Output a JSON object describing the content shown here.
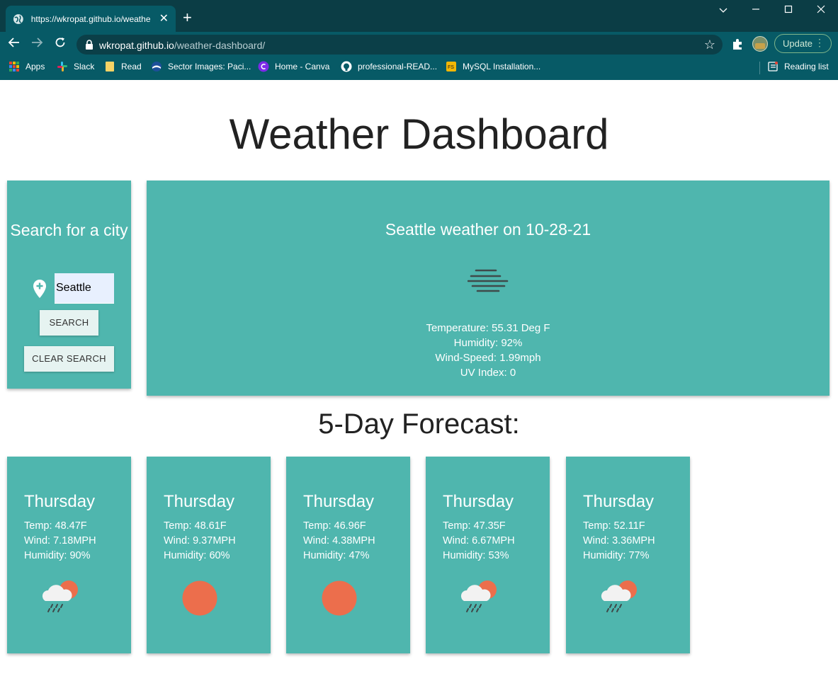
{
  "browser": {
    "tab_title": "https://wkropat.github.io/weathe",
    "tab_close": "✕",
    "new_tab": "+",
    "url_domain": "wkropat.github.io",
    "url_path": "/weather-dashboard/",
    "update_label": "Update",
    "bookmarks": [
      {
        "label": "Apps",
        "icon": "apps-grid-icon"
      },
      {
        "label": "Slack",
        "icon": "slack-icon"
      },
      {
        "label": "Read",
        "icon": "folder-icon"
      },
      {
        "label": "Sector Images: Paci...",
        "icon": "noaa-icon"
      },
      {
        "label": "Home - Canva",
        "icon": "canva-icon"
      },
      {
        "label": "professional-READ...",
        "icon": "github-icon"
      },
      {
        "label": "MySQL Installation...",
        "icon": "mysql-icon"
      }
    ],
    "reading_list": "Reading list"
  },
  "page": {
    "title": "Weather Dashboard"
  },
  "search": {
    "heading": "Search for a city",
    "input_value": "Seattle",
    "search_button": "SEARCH",
    "clear_button": "CLEAR SEARCH"
  },
  "current": {
    "title": "Seattle weather on 10-28-21",
    "icon": "fog-icon",
    "temperature": "Temperature: 55.31 Deg F",
    "humidity": "Humidity: 92%",
    "wind": "Wind-Speed: 1.99mph",
    "uv": "UV Index: 0"
  },
  "forecast": {
    "title": "5-Day Forecast:",
    "days": [
      {
        "day": "Thursday",
        "temp": "Temp: 48.47F",
        "wind": "Wind: 7.18MPH",
        "humidity": "Humidity: 90%",
        "icon": "rain-cloud-sun-icon"
      },
      {
        "day": "Thursday",
        "temp": "Temp: 48.61F",
        "wind": "Wind: 9.37MPH",
        "humidity": "Humidity: 60%",
        "icon": "sun-icon"
      },
      {
        "day": "Thursday",
        "temp": "Temp: 46.96F",
        "wind": "Wind: 4.38MPH",
        "humidity": "Humidity: 47%",
        "icon": "sun-icon"
      },
      {
        "day": "Thursday",
        "temp": "Temp: 47.35F",
        "wind": "Wind: 6.67MPH",
        "humidity": "Humidity: 53%",
        "icon": "rain-cloud-sun-icon"
      },
      {
        "day": "Thursday",
        "temp": "Temp: 52.11F",
        "wind": "Wind: 3.36MPH",
        "humidity": "Humidity: 77%",
        "icon": "rain-cloud-sun-icon"
      }
    ]
  },
  "colors": {
    "card": "#4fb6ae",
    "sun": "#ec6e4c",
    "chrome": "#075a66"
  }
}
